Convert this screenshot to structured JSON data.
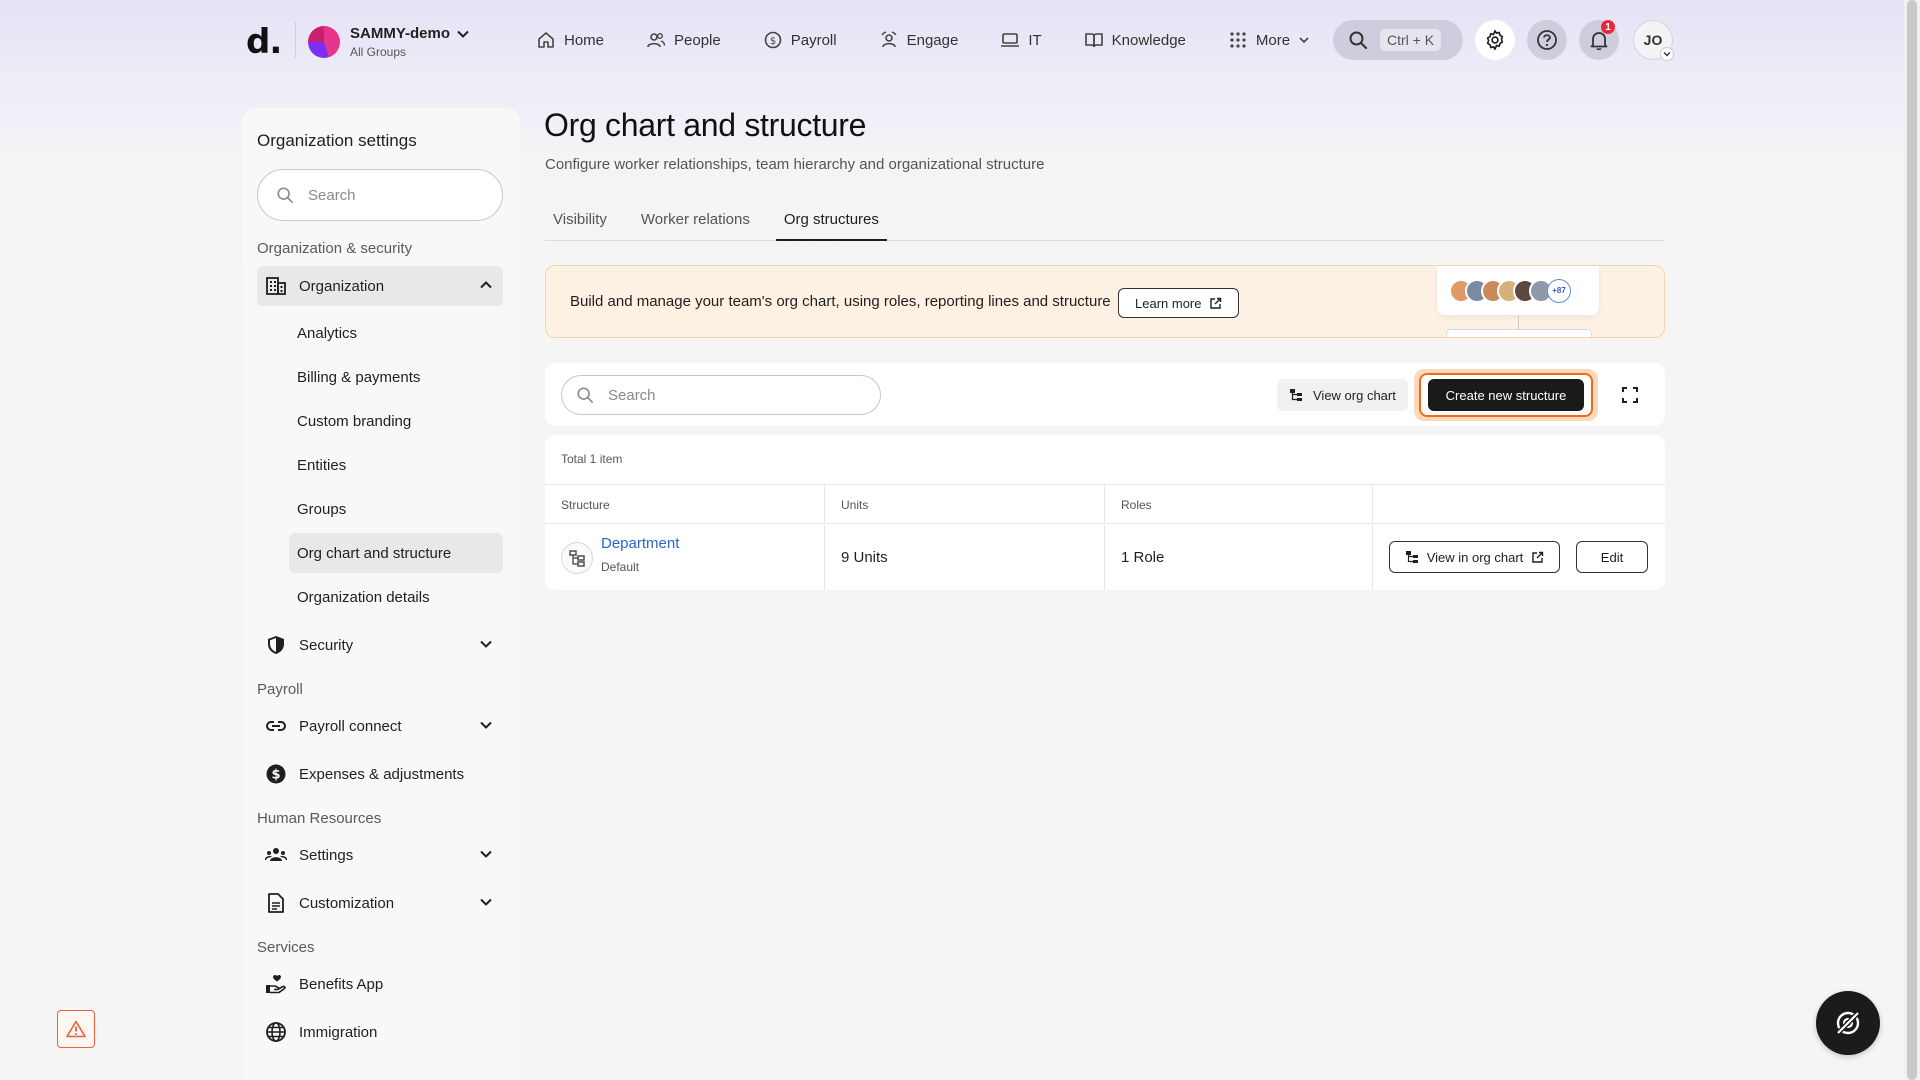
{
  "header": {
    "logo": "d.",
    "org_name": "SAMMY-demo",
    "org_sub": "All Groups",
    "nav": [
      {
        "label": "Home",
        "icon": "home-icon"
      },
      {
        "label": "People",
        "icon": "people-icon"
      },
      {
        "label": "Payroll",
        "icon": "payroll-icon"
      },
      {
        "label": "Engage",
        "icon": "engage-icon"
      },
      {
        "label": "IT",
        "icon": "laptop-icon"
      },
      {
        "label": "Knowledge",
        "icon": "book-icon"
      },
      {
        "label": "More",
        "icon": "grid-icon"
      }
    ],
    "search_shortcut": "Ctrl + K",
    "notification_count": "1",
    "user_initials": "JO"
  },
  "sidebar": {
    "title": "Organization settings",
    "search_placeholder": "Search",
    "sections": {
      "org_security": "Organization & security",
      "payroll": "Payroll",
      "hr": "Human Resources",
      "services": "Services"
    },
    "organization": "Organization",
    "org_sub_items": [
      "Analytics",
      "Billing & payments",
      "Custom branding",
      "Entities",
      "Groups",
      "Org chart and structure",
      "Organization details"
    ],
    "security": "Security",
    "payroll_connect": "Payroll connect",
    "expenses": "Expenses & adjustments",
    "settings": "Settings",
    "customization": "Customization",
    "benefits": "Benefits App",
    "immigration": "Immigration"
  },
  "main": {
    "title": "Org chart and structure",
    "subtitle": "Configure worker relationships, team hierarchy and organizational structure",
    "tabs": [
      "Visibility",
      "Worker relations",
      "Org structures"
    ],
    "active_tab": "Org structures",
    "banner": {
      "text": "Build and manage your team's org chart, using roles, reporting lines and structure",
      "learn_more": "Learn more",
      "more_count": "+87"
    },
    "toolbar": {
      "search_placeholder": "Search",
      "view_org_chart": "View org chart",
      "create_new": "Create new structure"
    },
    "table": {
      "total": "Total 1 item",
      "headers": [
        "Structure",
        "Units",
        "Roles",
        ""
      ],
      "rows": [
        {
          "structure": "Department",
          "tag": "Default",
          "units": "9 Units",
          "roles": "1 Role",
          "view_btn": "View in org chart",
          "edit_btn": "Edit"
        }
      ]
    }
  },
  "colors": {
    "accent_orange": "#ef6a1c",
    "link_blue": "#2a66c9",
    "badge_red": "#e52b3b",
    "banner_bg": "#fdf1e3"
  }
}
